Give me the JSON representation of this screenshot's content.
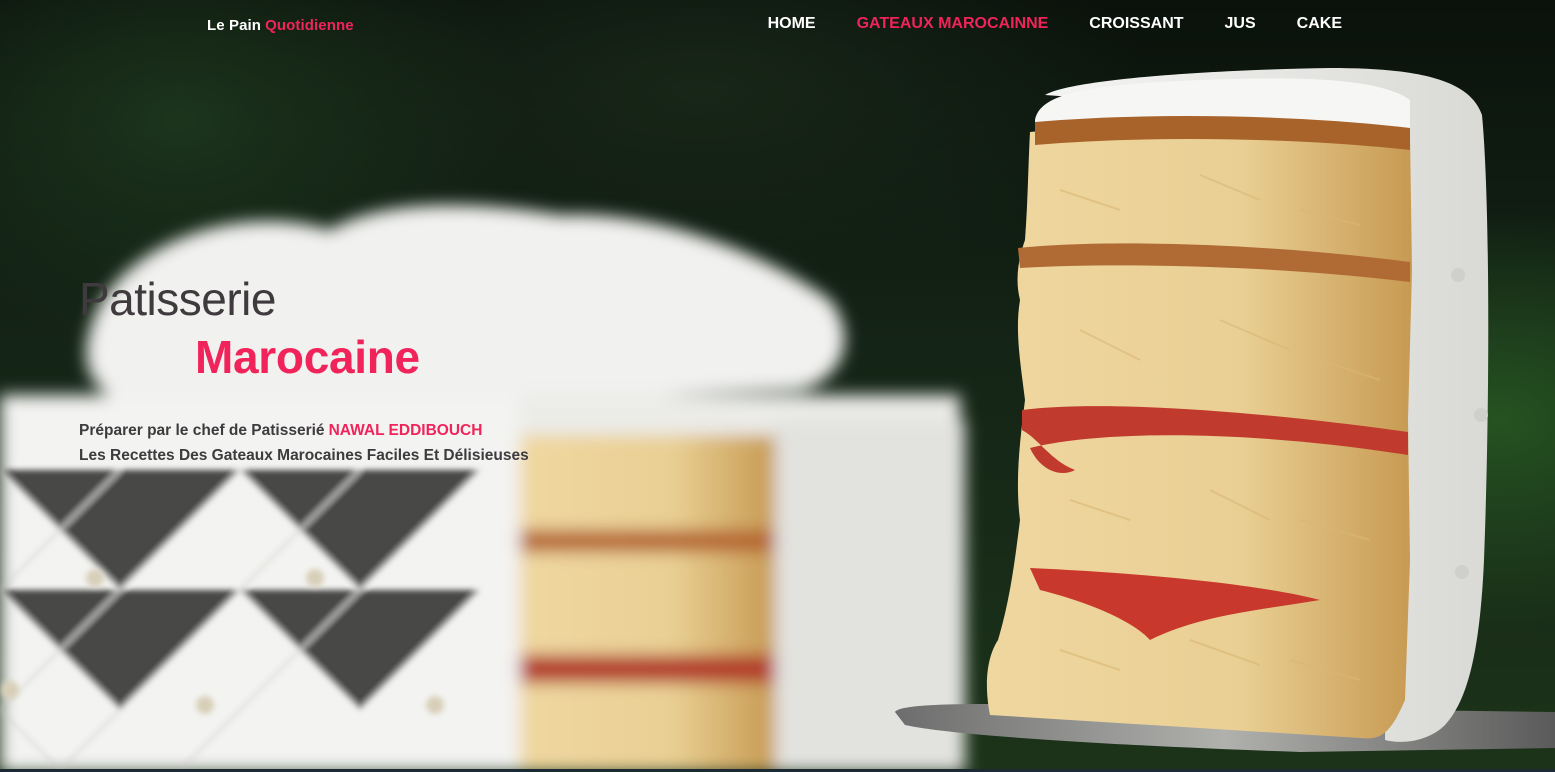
{
  "brand": {
    "name": "Le Pain",
    "accent": "Quotidienne"
  },
  "nav": {
    "items": [
      {
        "label": "HOME",
        "active": false
      },
      {
        "label": "GATEAUX MAROCAINNE",
        "active": true
      },
      {
        "label": "CROISSANT",
        "active": false
      },
      {
        "label": "JUS",
        "active": false
      },
      {
        "label": "CAKE",
        "active": false
      }
    ]
  },
  "hero": {
    "title_line1": "Patisserie",
    "title_line2": "Marocaine",
    "subtitle_prefix": "Préparer par le chef de Patisserié",
    "chef_name": "NAWAL EDDIBOUCH",
    "subtitle_line2": "Les Recettes Des Gateaux Marocaines Faciles Et Délisieuses"
  },
  "colors": {
    "accent": "#f0245a",
    "nav_text": "#ffffff",
    "hero_text": "#3d3b3d"
  }
}
